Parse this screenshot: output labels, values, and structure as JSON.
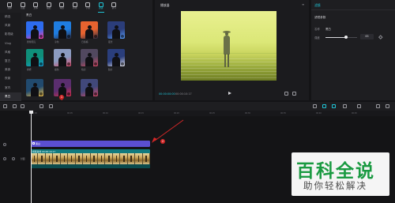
{
  "toolbar": {
    "tools": [
      {
        "label": "媒体",
        "icon": "media-icon"
      },
      {
        "label": "音频",
        "icon": "audio-icon"
      },
      {
        "label": "文本",
        "icon": "text-icon"
      },
      {
        "label": "贴纸",
        "icon": "sticker-icon"
      },
      {
        "label": "特效",
        "icon": "effects-icon"
      },
      {
        "label": "转场",
        "icon": "transition-icon"
      },
      {
        "label": "字幕",
        "icon": "subtitle-icon"
      },
      {
        "label": "滤镜",
        "icon": "filter-icon"
      },
      {
        "label": "调节",
        "icon": "adjust-icon"
      }
    ],
    "active_index": 7
  },
  "categories": {
    "items": [
      "精选",
      "风景",
      "影视级",
      "Vlog",
      "风格",
      "复古",
      "美食",
      "夜景",
      "室内",
      "黑白"
    ],
    "active_index": 9
  },
  "filter_grid": {
    "title": "黑白",
    "items": [
      {
        "label": "赛博朋克",
        "bg": "#2d6cf0",
        "accent": "#ff3fa8"
      },
      {
        "label": "冷色",
        "bg": "#1f7de0",
        "accent": "#2a2a40"
      },
      {
        "label": "日落橘",
        "bg": "#e7632f",
        "accent": "#2a2a40"
      },
      {
        "label": "夜景",
        "bg": "#2b3d7a",
        "accent": "#5aa0ff"
      },
      {
        "label": "绿妍",
        "bg": "#0f8f7a",
        "accent": "#14a0d9"
      },
      {
        "label": "褪色",
        "bg": "#8b9bc0",
        "accent": "#d84b6a"
      },
      {
        "label": "暗房",
        "bg": "#51485f",
        "accent": "#d84b6a"
      },
      {
        "label": "胶片",
        "bg": "#2a3e7c",
        "accent": "#e2e2ea"
      },
      {
        "label": "旧色调",
        "bg": "#214a6e",
        "accent": "#f2c24a"
      },
      {
        "label": "高饱和",
        "bg": "#5a2e6e",
        "accent": "#e03050"
      },
      {
        "label": "黑白",
        "bg": "#41487a",
        "accent": "#d84b6a"
      }
    ]
  },
  "player": {
    "title": "播放器",
    "time_current": "00:00:00:00",
    "time_total": "00:00:10:17",
    "menu": "≡"
  },
  "right_panel": {
    "tab": "滤镜",
    "section_title": "滤镜参数",
    "name_label": "名称",
    "name_value": "黑白",
    "strength_label": "强度",
    "strength_value": "65",
    "strength_fraction": 0.65
  },
  "timeline": {
    "ruler_ticks": [
      "00:00",
      "00:05",
      "00:10",
      "00:15",
      "00:20",
      "00:25",
      "00:30",
      "00:35",
      "00:40",
      "00:45"
    ],
    "filter_clip_label": "黑白",
    "video_clip_label": "视频素材  00:00:10:17",
    "track_label": "封面"
  },
  "annotations": {
    "badge1": "1",
    "badge2": "2",
    "color": "#d32727"
  },
  "watermark": {
    "title": "百科全说",
    "subtitle": "助你轻松解决"
  },
  "colors": {
    "accent": "#20c4d6",
    "filter_clip": "#5b4fd1",
    "video_clip": "#0e5f63"
  }
}
